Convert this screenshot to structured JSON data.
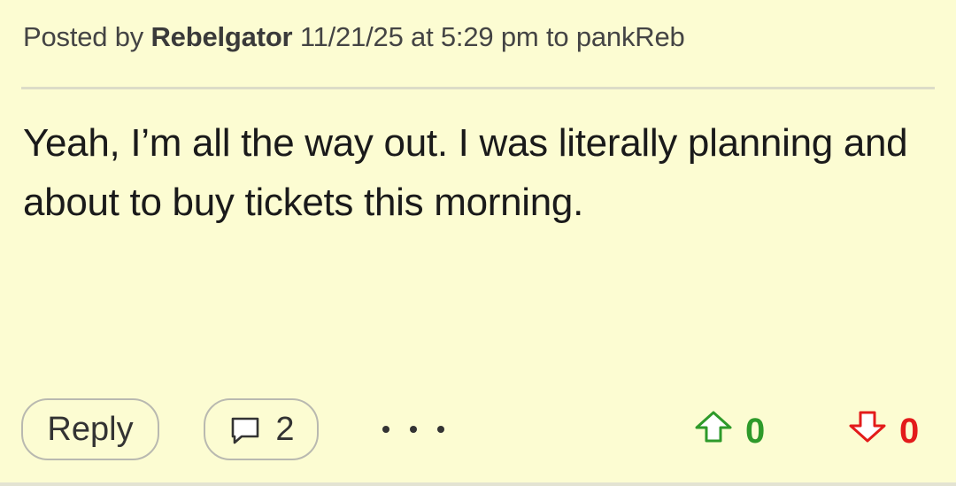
{
  "header": {
    "posted_by_label": "Posted by",
    "author": "Rebelgator",
    "timestamp": "11/21/25 at 5:29 pm",
    "to_label": "to",
    "reply_to": "pankReb"
  },
  "post": {
    "body": "Yeah, I’m all the way out. I was literally planning and about to buy tickets this morning."
  },
  "actions": {
    "reply_label": "Reply",
    "comment_count": "2",
    "upvotes": "0",
    "downvotes": "0"
  },
  "colors": {
    "background": "#fcfcd2",
    "upvote": "#2e9a2a",
    "downvote": "#e31b1b"
  },
  "icons": {
    "comment": "comment-icon",
    "more": "more-icon",
    "upvote": "arrow-up-icon",
    "downvote": "arrow-down-icon"
  }
}
